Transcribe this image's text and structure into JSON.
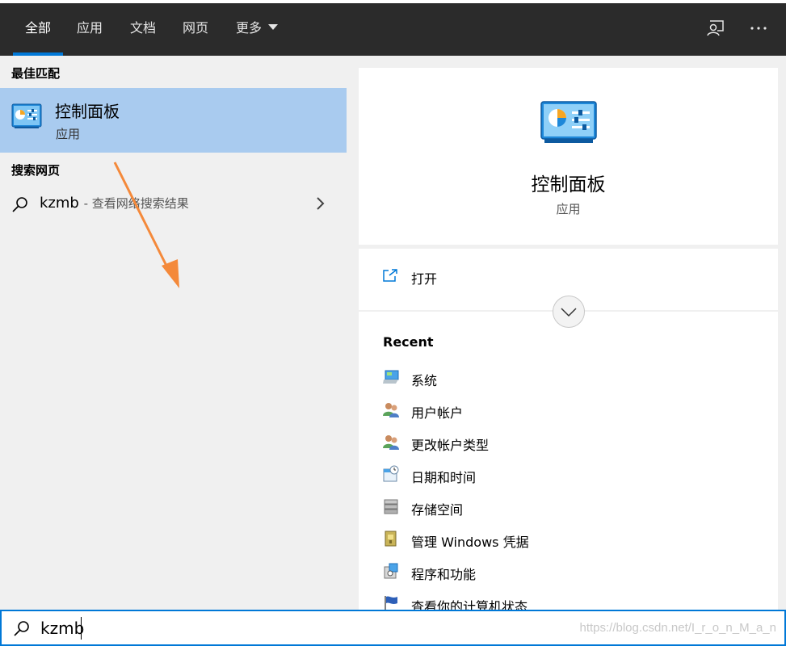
{
  "topbar": {
    "tabs": [
      {
        "label": "全部",
        "active": true
      },
      {
        "label": "应用",
        "active": false
      },
      {
        "label": "文档",
        "active": false
      },
      {
        "label": "网页",
        "active": false
      },
      {
        "label": "更多",
        "active": false
      }
    ],
    "icons": [
      "feedback-icon",
      "more-options-icon"
    ]
  },
  "left": {
    "best_match_title": "最佳匹配",
    "best_match": {
      "name": "控制面板",
      "type": "应用",
      "icon": "control-panel-icon"
    },
    "web_title": "搜索网页",
    "web_item": {
      "query": "kzmb",
      "hint": "- 查看网络搜索结果"
    }
  },
  "right": {
    "app_name": "控制面板",
    "app_type": "应用",
    "open_label": "打开",
    "recent_title": "Recent",
    "recent": [
      {
        "label": "系统",
        "icon": "system-icon"
      },
      {
        "label": "用户帐户",
        "icon": "user-accounts-icon"
      },
      {
        "label": "更改帐户类型",
        "icon": "user-accounts-icon"
      },
      {
        "label": "日期和时间",
        "icon": "date-time-icon"
      },
      {
        "label": "存储空间",
        "icon": "storage-icon"
      },
      {
        "label": "管理 Windows 凭据",
        "icon": "credentials-icon"
      },
      {
        "label": "程序和功能",
        "icon": "programs-icon"
      },
      {
        "label": "查看你的计算机状态",
        "icon": "flag-icon"
      }
    ]
  },
  "search": {
    "value": "kzmb"
  },
  "watermark": "https://blog.csdn.net/I_r_o_n_M_a_n",
  "colors": {
    "accent": "#0078d7",
    "selection": "#a9cbef",
    "topbar": "#2b2b2b",
    "annotation_arrow": "#f4893a"
  }
}
